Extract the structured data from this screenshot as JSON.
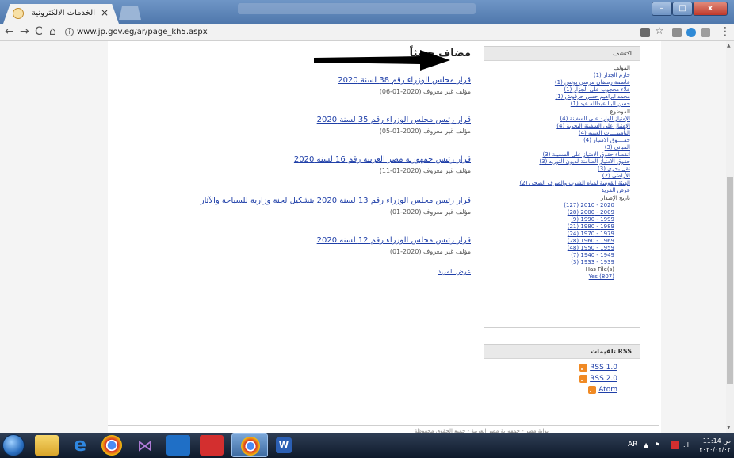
{
  "browser": {
    "tab_title": "الخدمات الالكترونية",
    "tab_close": "×",
    "address": "www.jp.gov.eg/ar/page_kh5.aspx",
    "nav": {
      "back": "←",
      "forward": "→",
      "reload": "C",
      "home": "⌂"
    },
    "menu": "⋮",
    "star": "☆"
  },
  "main": {
    "section_title": "مضاف حديثاً",
    "results": [
      {
        "title": "قرار مجلس الوزراء رقم 38 لسنة 2020",
        "meta": "مؤلف غير معروف (2020-01-06)"
      },
      {
        "title": "قرار رئيس مجلس الوزراء رقم 35 لسنة 2020",
        "meta": "مؤلف غير معروف (2020-01-05)"
      },
      {
        "title": "قرار رئيس جمهورية مصر العربية رقم 16 لسنة 2020",
        "meta": "مؤلف غير معروف (2020-01-11)"
      },
      {
        "title": "قرار رئيس مجلس الوزراء رقم 13 لسنة 2020 بتشكيل لجنة وزارية للسياحة والآثار",
        "meta": "مؤلف غير معروف (2020-01)"
      },
      {
        "title": "قرار رئيس مجلس الوزراء رقم 12 لسنة 2020",
        "meta": "مؤلف غير معروف (2020-01)"
      }
    ],
    "more_link": "عرض المزيد"
  },
  "sidebar": {
    "header": "اكتشف",
    "author_label": "المؤلف",
    "authors": [
      "حازم الجدار (1)",
      "عاصمة رمضان مرسي يونس (1)",
      "علاء محجوب على الجزار (1)",
      "محمد ابراهيم حسن حرفوش (1)",
      "حسن البنا عبدالله عيد (1)"
    ],
    "subject_label": "الموضوع",
    "subjects": [
      "الإمتياز الوارد على السفينة (4)",
      "الإمتياز على السفينة البحرية (4)",
      "التأمينــــات العينية (4)",
      "حقــــوق الامتياز (4)",
      "المبانى (3)",
      "انقضاء حقوق الامتياز على السفينة (3)",
      "حقوق الامتياز الضامنة لديون التوريد (3)",
      "نقل بحرى (3)",
      "الأراضى (2)",
      "الهيئة القومية لمياه الشرب والصرف الصحى (2)"
    ],
    "subjects_more": "عرض المزيد",
    "date_label": "تاريخ الإصدار",
    "dates": [
      "2020 - 2010 (127)",
      "2009 - 2000 (28)",
      "1999 - 1990 (9)",
      "1989 - 1980 (21)",
      "1979 - 1970 (24)",
      "1969 - 1960 (28)",
      "1959 - 1950 (48)",
      "1949 - 1940 (7)",
      "1939 - 1933 (3)"
    ],
    "has_files_label": "Has File(s)",
    "has_files_yes": "Yes (807)"
  },
  "rss": {
    "header": "RSS تلقيمات",
    "links": [
      "RSS 1.0",
      "RSS 2.0",
      "Atom"
    ]
  },
  "footer": {
    "text": "بوابة مصر - جمهورية مصر العربية - جميع الحقوق محفوظة"
  },
  "taskbar": {
    "lang": "AR",
    "time": "11:14 ص",
    "date": "٢٠٢٠/٠٢/٠٢"
  },
  "colors": {
    "link": "#1f3fa8",
    "titlebar": "#5b84b8",
    "taskbar": "#1a2638",
    "rss": "#f08a24"
  }
}
